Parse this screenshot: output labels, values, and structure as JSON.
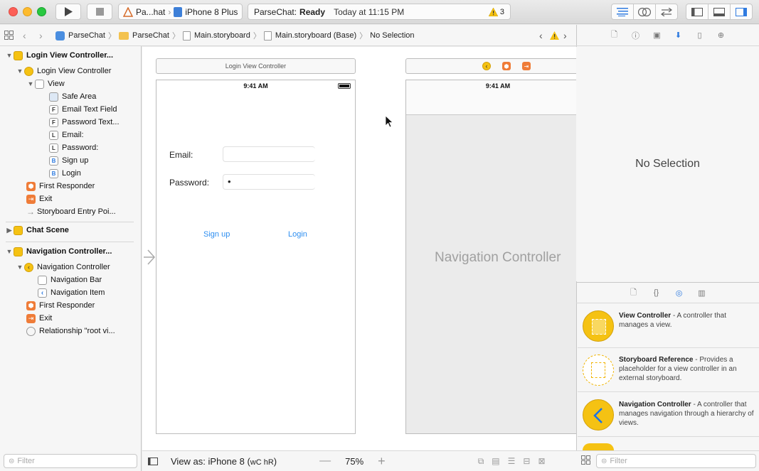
{
  "toolbar": {
    "scheme_target": "Pa...hat",
    "scheme_device": "iPhone 8 Plus",
    "status_app": "ParseChat:",
    "status_state": "Ready",
    "status_time": "Today at 11:15 PM",
    "warning_count": "3"
  },
  "breadcrumb": [
    "ParseChat",
    "ParseChat",
    "Main.storyboard",
    "Main.storyboard (Base)",
    "No Selection"
  ],
  "navigator": {
    "scene1_title": "Login View Controller...",
    "scene1_vc": "Login View Controller",
    "view": "View",
    "safe_area": "Safe Area",
    "email_text_field": "Email Text Field",
    "password_text": "Password Text...",
    "email_label": "Email:",
    "password_label": "Password:",
    "sign_up": "Sign up",
    "login": "Login",
    "first_responder_1": "First Responder",
    "exit_1": "Exit",
    "entry_point": "Storyboard Entry Poi...",
    "scene2_title": "Chat Scene",
    "scene3_title": "Navigation Controller...",
    "nav_controller": "Navigation Controller",
    "nav_bar": "Navigation Bar",
    "nav_item": "Navigation Item",
    "first_responder_2": "First Responder",
    "exit_2": "Exit",
    "relationship": "Relationship \"root vi...",
    "filter_placeholder": "Filter"
  },
  "canvas": {
    "login_scene_title": "Login View Controller",
    "status_time": "9:41 AM",
    "email_label": "Email:",
    "password_label": "Password:",
    "password_value": "•",
    "signup_button": "Sign up",
    "login_button": "Login",
    "nav_status_time": "9:41 AM",
    "nav_controller_label": "Navigation Controller"
  },
  "canvas_bottom": {
    "view_as": "View as: iPhone 8 (",
    "size_class": "wC hR",
    "view_as_end": ")",
    "zoom": "75%"
  },
  "inspector": {
    "no_selection": "No Selection",
    "filter_placeholder": "Filter"
  },
  "library": [
    {
      "title": "View Controller",
      "desc": " - A controller that manages a view."
    },
    {
      "title": "Storyboard Reference",
      "desc": " - Provides a placeholder for a view controller in an external storyboard."
    },
    {
      "title": "Navigation Controller",
      "desc": " - A controller that manages navigation through a hierarchy of views."
    }
  ],
  "colors": {
    "accent": "#1a73e8",
    "yellow": "#f5c213",
    "orange": "#ef7c38",
    "link_blue": "#2d8ef0"
  }
}
